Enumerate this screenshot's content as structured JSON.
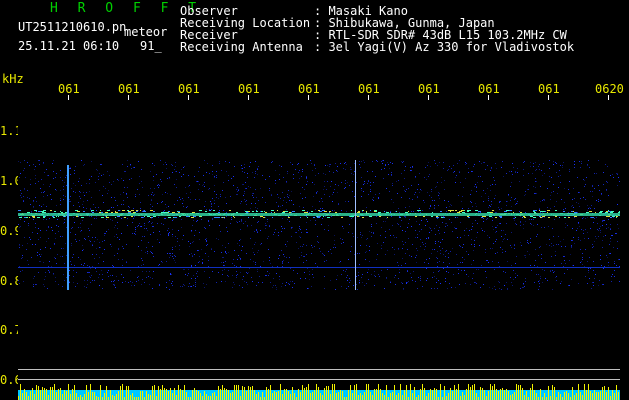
{
  "header": {
    "title": "H R O F F T",
    "filename": "UT2511210610.pn",
    "meteor_label": "meteor",
    "datetime": "25.11.21 06:10",
    "count": "91_",
    "info": [
      {
        "label": "Observer",
        "value": ": Masaki Kano"
      },
      {
        "label": "Receiving Location",
        "value": ": Shibukawa, Gunma, Japan"
      },
      {
        "label": "Receiver",
        "value": ": RTL-SDR SDR# 43dB L15 103.2MHz CW"
      },
      {
        "label": "Receiving Antenna",
        "value": ": 3el Yagi(V) Az 330 for Vladivostok"
      }
    ]
  },
  "axes": {
    "y_unit": "kHz",
    "y_ticks": [
      "1.1",
      "1.0",
      "0.9",
      "0.8",
      "0.7",
      "0.6"
    ],
    "x_ticks": [
      "061",
      "061",
      "061",
      "061",
      "061",
      "061",
      "061",
      "061",
      "061",
      "0620"
    ]
  },
  "colors": {
    "title": "#00d000",
    "axis_labels": "#e8e800",
    "text": "#ffffff",
    "carrier": "#40e0a0",
    "noise": "#0010a0",
    "bottom_bar_cyan": "#00c8ff",
    "bottom_bar_yellow": "#f0f000"
  },
  "spectrogram": {
    "carrier_khz": 0.93,
    "meteor_events_minute_fraction": [
      0.08,
      0.56
    ]
  }
}
